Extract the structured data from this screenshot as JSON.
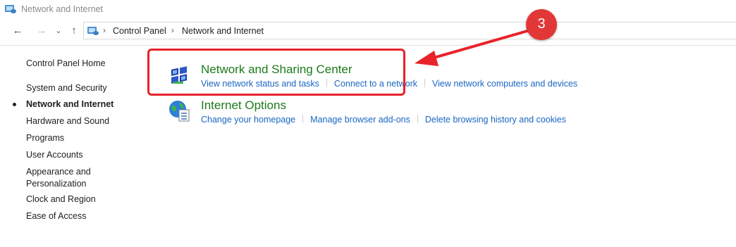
{
  "window": {
    "title": "Network and Internet"
  },
  "address_bar": {
    "crumbs": [
      "Control Panel",
      "Network and Internet"
    ]
  },
  "sidebar": {
    "home": "Control Panel Home",
    "items": [
      {
        "label": "System and Security"
      },
      {
        "label": "Network and Internet",
        "active": true
      },
      {
        "label": "Hardware and Sound"
      },
      {
        "label": "Programs"
      },
      {
        "label": "User Accounts"
      },
      {
        "label": "Appearance and"
      },
      {
        "label": "Personalization"
      },
      {
        "label": "Clock and Region"
      },
      {
        "label": "Ease of Access"
      }
    ]
  },
  "categories": [
    {
      "title": "Network and Sharing Center",
      "icon": "network-sharing-icon",
      "links": [
        "View network status and tasks",
        "Connect to a network",
        "View network computers and devices"
      ]
    },
    {
      "title": "Internet Options",
      "icon": "internet-options-icon",
      "links": [
        "Change your homepage",
        "Manage browser add-ons",
        "Delete browsing history and cookies"
      ]
    }
  ],
  "annotation": {
    "step": "3",
    "color": "#e23737"
  },
  "colors": {
    "link": "#1a66c2",
    "category_title": "#1c7a1c",
    "highlight": "#e8232a"
  }
}
